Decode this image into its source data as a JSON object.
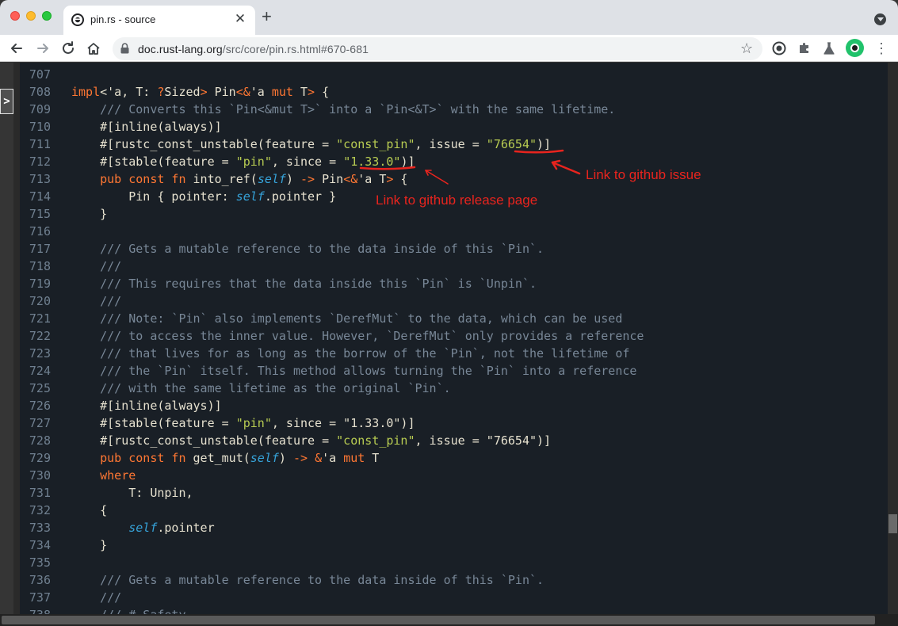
{
  "browser": {
    "tab_title": "pin.rs - source",
    "tab_close": "✕",
    "new_tab": "+",
    "url_host": "doc.rust-lang.org",
    "url_path": "/src/core/pin.rs.html#670-681",
    "icons": {
      "back": "back-arrow-icon",
      "forward": "forward-arrow-icon",
      "reload": "reload-icon",
      "home": "home-icon",
      "lock": "lock-icon",
      "star": "star-icon",
      "menu": "kebab-menu-icon"
    }
  },
  "sidebar": {
    "toggle_label": ">"
  },
  "code_lines": [
    {
      "n": "707",
      "tokens": []
    },
    {
      "n": "708",
      "tokens": [
        [
          "kw",
          "impl"
        ],
        [
          "plain",
          "<'a, T: "
        ],
        [
          "kw",
          "?"
        ],
        [
          "plain",
          "Sized"
        ],
        [
          "kw",
          ">"
        ],
        [
          "plain",
          " Pin"
        ],
        [
          "kw",
          "<&"
        ],
        [
          "plain",
          "'a "
        ],
        [
          "kw",
          "mut"
        ],
        [
          "plain",
          " T"
        ],
        [
          "kw",
          ">"
        ],
        [
          "plain",
          " {"
        ]
      ]
    },
    {
      "n": "709",
      "tokens": [
        [
          "plain",
          "    "
        ],
        [
          "cm",
          "/// Converts this `Pin<&mut T>` into a `Pin<&T>` with the same lifetime."
        ]
      ]
    },
    {
      "n": "710",
      "tokens": [
        [
          "plain",
          "    #[inline(always)]"
        ]
      ]
    },
    {
      "n": "711",
      "tokens": [
        [
          "plain",
          "    #[rustc_const_unstable(feature = "
        ],
        [
          "str",
          "\"const_pin\""
        ],
        [
          "plain",
          ", issue = "
        ],
        [
          "str",
          "\"76654\""
        ],
        [
          "plain",
          ")]"
        ]
      ]
    },
    {
      "n": "712",
      "tokens": [
        [
          "plain",
          "    #[stable(feature = "
        ],
        [
          "str",
          "\"pin\""
        ],
        [
          "plain",
          ", since = "
        ],
        [
          "str",
          "\"1.33.0\""
        ],
        [
          "plain",
          ")]"
        ]
      ]
    },
    {
      "n": "713",
      "tokens": [
        [
          "plain",
          "    "
        ],
        [
          "kw",
          "pub const fn"
        ],
        [
          "plain",
          " into_ref("
        ],
        [
          "slf",
          "self"
        ],
        [
          "plain",
          ") "
        ],
        [
          "kw",
          "->"
        ],
        [
          "plain",
          " Pin"
        ],
        [
          "kw",
          "<&"
        ],
        [
          "plain",
          "'a T"
        ],
        [
          "kw",
          ">"
        ],
        [
          "plain",
          " {"
        ]
      ]
    },
    {
      "n": "714",
      "tokens": [
        [
          "plain",
          "        Pin { pointer: "
        ],
        [
          "slf",
          "self"
        ],
        [
          "plain",
          ".pointer }"
        ]
      ]
    },
    {
      "n": "715",
      "tokens": [
        [
          "plain",
          "    }"
        ]
      ]
    },
    {
      "n": "716",
      "tokens": []
    },
    {
      "n": "717",
      "tokens": [
        [
          "plain",
          "    "
        ],
        [
          "cm",
          "/// Gets a mutable reference to the data inside of this `Pin`."
        ]
      ]
    },
    {
      "n": "718",
      "tokens": [
        [
          "plain",
          "    "
        ],
        [
          "cm",
          "///"
        ]
      ]
    },
    {
      "n": "719",
      "tokens": [
        [
          "plain",
          "    "
        ],
        [
          "cm",
          "/// This requires that the data inside this `Pin` is `Unpin`."
        ]
      ]
    },
    {
      "n": "720",
      "tokens": [
        [
          "plain",
          "    "
        ],
        [
          "cm",
          "///"
        ]
      ]
    },
    {
      "n": "721",
      "tokens": [
        [
          "plain",
          "    "
        ],
        [
          "cm",
          "/// Note: `Pin` also implements `DerefMut` to the data, which can be used"
        ]
      ]
    },
    {
      "n": "722",
      "tokens": [
        [
          "plain",
          "    "
        ],
        [
          "cm",
          "/// to access the inner value. However, `DerefMut` only provides a reference"
        ]
      ]
    },
    {
      "n": "723",
      "tokens": [
        [
          "plain",
          "    "
        ],
        [
          "cm",
          "/// that lives for as long as the borrow of the `Pin`, not the lifetime of"
        ]
      ]
    },
    {
      "n": "724",
      "tokens": [
        [
          "plain",
          "    "
        ],
        [
          "cm",
          "/// the `Pin` itself. This method allows turning the `Pin` into a reference"
        ]
      ]
    },
    {
      "n": "725",
      "tokens": [
        [
          "plain",
          "    "
        ],
        [
          "cm",
          "/// with the same lifetime as the original `Pin`."
        ]
      ]
    },
    {
      "n": "726",
      "tokens": [
        [
          "plain",
          "    #[inline(always)]"
        ]
      ]
    },
    {
      "n": "727",
      "tokens": [
        [
          "plain",
          "    #[stable(feature = "
        ],
        [
          "str",
          "\"pin\""
        ],
        [
          "plain",
          ", since = \"1.33.0\")]"
        ]
      ]
    },
    {
      "n": "728",
      "tokens": [
        [
          "plain",
          "    #[rustc_const_unstable(feature = "
        ],
        [
          "str",
          "\"const_pin\""
        ],
        [
          "plain",
          ", issue = \"76654\")]"
        ]
      ]
    },
    {
      "n": "729",
      "tokens": [
        [
          "plain",
          "    "
        ],
        [
          "kw",
          "pub const fn"
        ],
        [
          "plain",
          " get_mut("
        ],
        [
          "slf",
          "self"
        ],
        [
          "plain",
          ") "
        ],
        [
          "kw",
          "->"
        ],
        [
          "plain",
          " "
        ],
        [
          "kw",
          "&"
        ],
        [
          "plain",
          "'a "
        ],
        [
          "kw",
          "mut"
        ],
        [
          "plain",
          " T"
        ]
      ]
    },
    {
      "n": "730",
      "tokens": [
        [
          "plain",
          "    "
        ],
        [
          "kw",
          "where"
        ]
      ]
    },
    {
      "n": "731",
      "tokens": [
        [
          "plain",
          "        T: Unpin,"
        ]
      ]
    },
    {
      "n": "732",
      "tokens": [
        [
          "plain",
          "    {"
        ]
      ]
    },
    {
      "n": "733",
      "tokens": [
        [
          "plain",
          "        "
        ],
        [
          "slf",
          "self"
        ],
        [
          "plain",
          ".pointer"
        ]
      ]
    },
    {
      "n": "734",
      "tokens": [
        [
          "plain",
          "    }"
        ]
      ]
    },
    {
      "n": "735",
      "tokens": []
    },
    {
      "n": "736",
      "tokens": [
        [
          "plain",
          "    "
        ],
        [
          "cm",
          "/// Gets a mutable reference to the data inside of this `Pin`."
        ]
      ]
    },
    {
      "n": "737",
      "tokens": [
        [
          "plain",
          "    "
        ],
        [
          "cm",
          "///"
        ]
      ]
    },
    {
      "n": "738",
      "tokens": [
        [
          "plain",
          "    "
        ],
        [
          "cm",
          "/// # Safety"
        ]
      ]
    }
  ],
  "annotations": {
    "issue_label": "Link to github issue",
    "release_label": "Link to github release page",
    "color": "#e8241e"
  }
}
